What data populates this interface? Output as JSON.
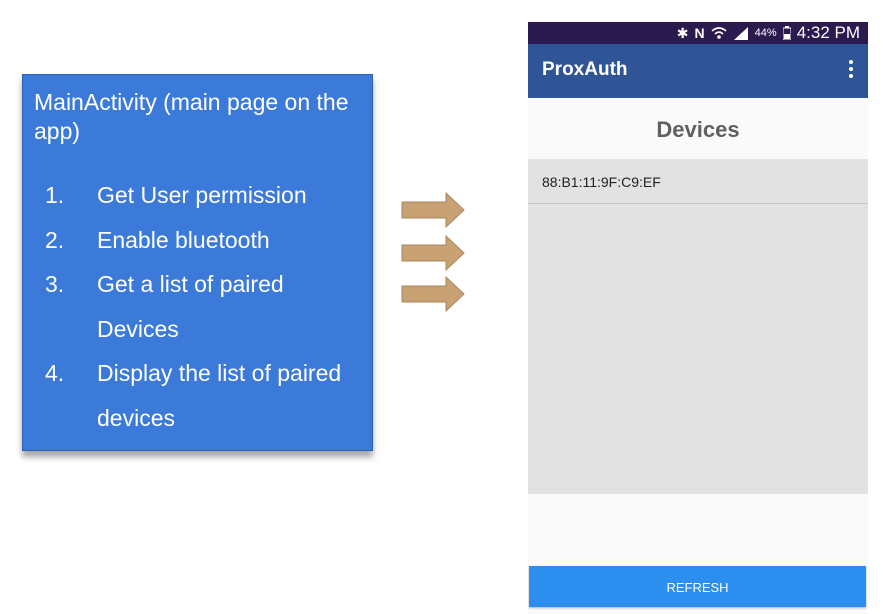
{
  "card": {
    "title": "MainActivity (main page on the app)",
    "steps": [
      {
        "num": "1.",
        "text": "Get User permission"
      },
      {
        "num": "2.",
        "text": "Enable bluetooth"
      },
      {
        "num": "3.",
        "text": "Get a list of paired Devices"
      },
      {
        "num": "4.",
        "text": "Display the list of paired devices"
      }
    ]
  },
  "arrows": {
    "count": 3,
    "color": "#c9a273"
  },
  "phone": {
    "status_bar": {
      "icons": [
        "bluetooth-icon",
        "nfc-icon",
        "wifi-icon",
        "signal-icon",
        "battery-icon"
      ],
      "battery": "44%",
      "time": "4:32 PM"
    },
    "app_bar": {
      "title": "ProxAuth",
      "menu_icon": "more-vert-icon"
    },
    "section_title": "Devices",
    "devices": [
      "88:B1:11:9F:C9:EF"
    ],
    "refresh_label": "REFRESH"
  },
  "colors": {
    "card_bg": "#3c7ad9",
    "app_bar": "#2f5597",
    "status_bar": "#2a1a4e",
    "button": "#2c8ff0",
    "list_bg": "#e2e2e2"
  }
}
